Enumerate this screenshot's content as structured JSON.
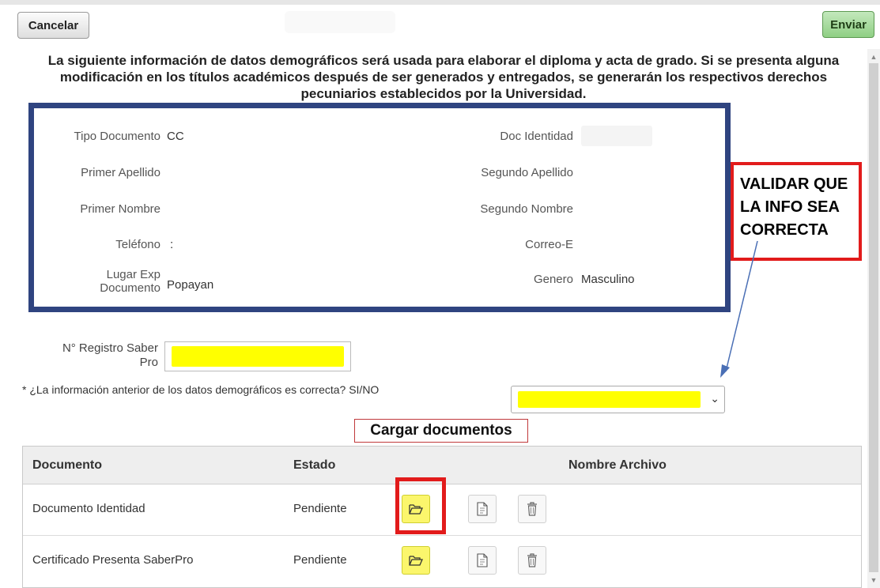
{
  "toolbar": {
    "cancel_label": "Cancelar",
    "send_label": "Enviar"
  },
  "intro": {
    "text": "La siguiente información de datos demográficos será usada para elaborar el diploma y acta de grado. Si se presenta alguna modificación en los títulos académicos después de ser generados y entregados, se generarán los respectivos derechos pecuniarios establecidos por la Universidad."
  },
  "demographics": {
    "tipo_documento": {
      "label": "Tipo Documento",
      "value": "CC"
    },
    "doc_identidad": {
      "label": "Doc Identidad",
      "value": ""
    },
    "primer_apellido": {
      "label": "Primer Apellido",
      "value": ""
    },
    "segundo_apellido": {
      "label": "Segundo Apellido",
      "value": ""
    },
    "primer_nombre": {
      "label": "Primer Nombre",
      "value": ""
    },
    "segundo_nombre": {
      "label": "Segundo Nombre",
      "value": ""
    },
    "telefono": {
      "label": "Teléfono",
      "value": ":"
    },
    "correo": {
      "label": "Correo-E",
      "value": ""
    },
    "lugar_exp": {
      "label_line1": "Lugar Exp",
      "label_line2": "Documento",
      "value": "Popayan"
    },
    "genero": {
      "label": "Genero",
      "value": "Masculino"
    }
  },
  "annotation": {
    "lines": [
      "VALIDAR QUE",
      "LA INFO SEA",
      "CORRECTA"
    ],
    "color": "#e21b1b"
  },
  "saber_pro": {
    "label_line1": "N° Registro Saber",
    "label_line2": "Pro",
    "value": ""
  },
  "question": {
    "text": "* ¿La información anterior de los datos demográficos es correcta? SI/NO",
    "selected": ""
  },
  "cargar": {
    "label": "Cargar documentos"
  },
  "documents": {
    "headers": [
      "Documento",
      "Estado",
      "Nombre Archivo"
    ],
    "rows": [
      {
        "documento": "Documento Identidad",
        "estado": "Pendiente"
      },
      {
        "documento": "Certificado Presenta SaberPro",
        "estado": "Pendiente"
      }
    ]
  },
  "colors": {
    "frame_border": "#2f4480",
    "highlight": "#ffff00",
    "send_button": "#8fcf84"
  }
}
